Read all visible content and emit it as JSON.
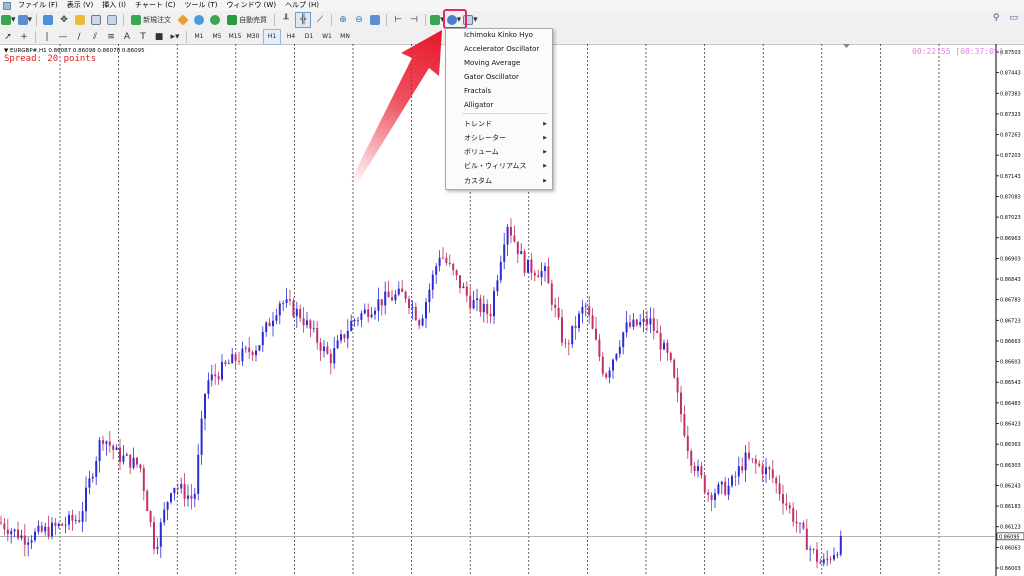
{
  "menubar": {
    "items": [
      "ファイル (F)",
      "表示 (V)",
      "挿入 (I)",
      "チャート (C)",
      "ツール (T)",
      "ウィンドウ (W)",
      "ヘルプ (H)"
    ]
  },
  "toolbar": {
    "new_order_label": "新規注文",
    "auto_trading_label": "自動売買"
  },
  "timeframes": [
    "M1",
    "M5",
    "M15",
    "M30",
    "H1",
    "H4",
    "D1",
    "W1",
    "MN"
  ],
  "chart": {
    "title": "▼ EURGBP#,H1  0.86087 0.86098 0.86070 0.86095",
    "spread": "Spread: 20 points",
    "clock": "00:22:55 [08:37:05]",
    "current_price": "0.86095",
    "price_labels": [
      "0.87503",
      "0.87443",
      "0.87383",
      "0.87323",
      "0.87263",
      "0.87203",
      "0.87143",
      "0.87083",
      "0.87023",
      "0.86963",
      "0.86903",
      "0.86843",
      "0.86783",
      "0.86723",
      "0.86663",
      "0.86603",
      "0.86543",
      "0.86483",
      "0.86423",
      "0.86363",
      "0.86303",
      "0.86243",
      "0.86183",
      "0.86123",
      "0.86063",
      "0.86003"
    ]
  },
  "indicator_menu": {
    "items": [
      {
        "label": "Ichimoku Kinko Hyo",
        "submenu": false
      },
      {
        "label": "Accelerator Oscillator",
        "submenu": false
      },
      {
        "label": "Moving Average",
        "submenu": false
      },
      {
        "label": "Gator Oscillator",
        "submenu": false
      },
      {
        "label": "Fractals",
        "submenu": false
      },
      {
        "label": "Alligator",
        "submenu": false
      },
      {
        "label": "トレンド",
        "submenu": true
      },
      {
        "label": "オシレーター",
        "submenu": true
      },
      {
        "label": "ボリューム",
        "submenu": true
      },
      {
        "label": "ビル・ウィリアムス",
        "submenu": true
      },
      {
        "label": "カスタム",
        "submenu": true
      }
    ]
  },
  "colors": {
    "bull": "#2b2bd6",
    "bear": "#c0306a",
    "grid": "#222222",
    "highlight": "#e5266f",
    "arrow": "#e8182c"
  }
}
